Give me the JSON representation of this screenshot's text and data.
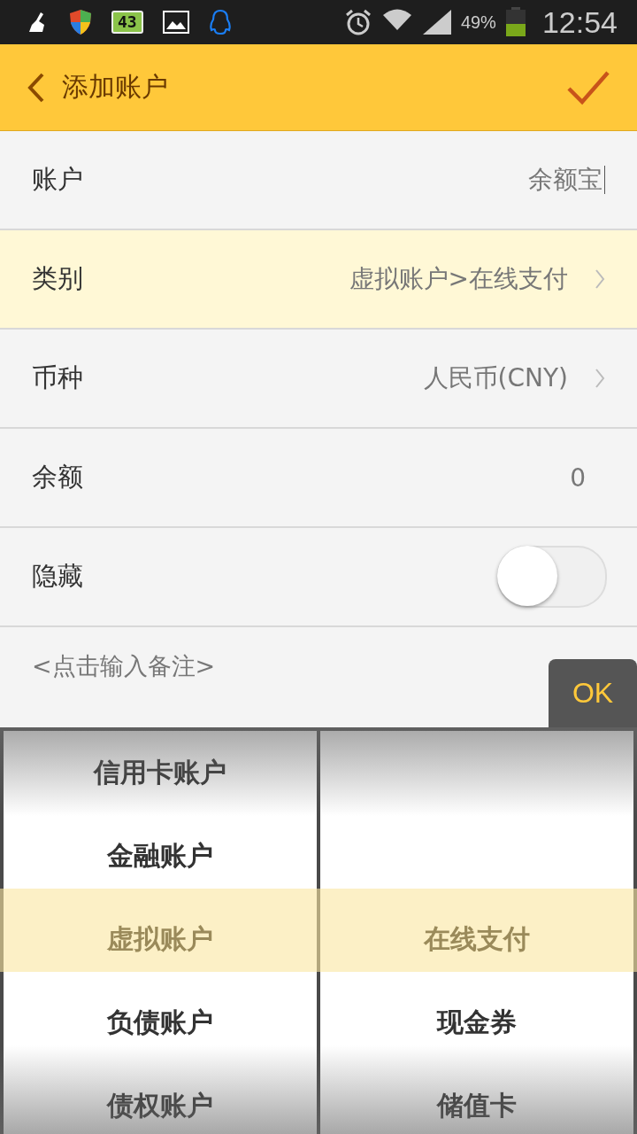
{
  "status_bar": {
    "notification_count": "43",
    "battery_percent": "49%",
    "time": "12:54"
  },
  "header": {
    "title": "添加账户"
  },
  "form": {
    "rows": [
      {
        "label": "账户",
        "value": "余额宝",
        "kind": "text",
        "selected": false
      },
      {
        "label": "类别",
        "value": "虚拟账户>在线支付",
        "kind": "select",
        "selected": true
      },
      {
        "label": "币种",
        "value": "人民币(CNY)",
        "kind": "select",
        "selected": false
      },
      {
        "label": "余额",
        "value": "0",
        "kind": "number",
        "selected": false
      },
      {
        "label": "隐藏",
        "kind": "toggle",
        "on": false,
        "selected": false
      }
    ],
    "note": {
      "placeholder": "<点击输入备注>"
    },
    "ok_button": "OK"
  },
  "picker": {
    "columns": [
      {
        "items": [
          {
            "label": "信用卡账户",
            "selected": false
          },
          {
            "label": "金融账户",
            "selected": false
          },
          {
            "label": "虚拟账户",
            "selected": true
          },
          {
            "label": "负债账户",
            "selected": false
          },
          {
            "label": "债权账户",
            "selected": false
          }
        ]
      },
      {
        "items": [
          {
            "label": "在线支付",
            "selected": true
          },
          {
            "label": "现金券",
            "selected": false
          },
          {
            "label": "储值卡",
            "selected": false
          }
        ]
      }
    ]
  }
}
